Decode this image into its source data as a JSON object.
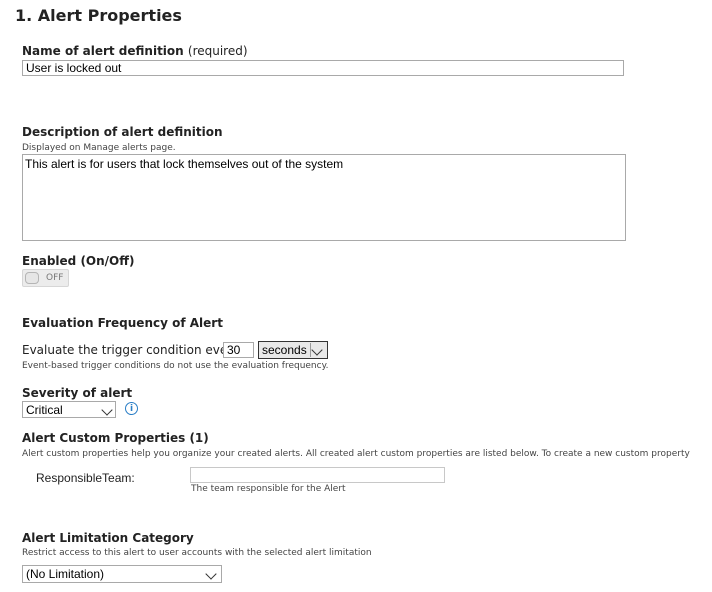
{
  "section_title": "1. Alert Properties",
  "name": {
    "label": "Name of alert definition",
    "required": "(required)",
    "value": "User is locked out"
  },
  "description": {
    "label": "Description of alert definition",
    "hint": "Displayed on Manage alerts page.",
    "value": "This alert is for users that lock themselves out of the system"
  },
  "enabled": {
    "label": "Enabled (On/Off)",
    "state_text": "OFF"
  },
  "evaluation": {
    "label": "Evaluation Frequency of Alert",
    "prefix": "Evaluate the trigger condition every",
    "interval_value": "30",
    "unit_selected": "seconds",
    "hint": "Event-based trigger conditions do not use the evaluation frequency."
  },
  "severity": {
    "label": "Severity of alert",
    "selected": "Critical",
    "info_icon": "info-icon"
  },
  "custom_properties": {
    "label": "Alert Custom Properties (1)",
    "hint": "Alert custom properties help you organize your created alerts. All created alert custom properties are listed below. To create a new custom property",
    "items": [
      {
        "name": "ResponsibleTeam:",
        "value": "",
        "hint": "The team responsible for the Alert"
      }
    ]
  },
  "limitation": {
    "label": "Alert Limitation Category",
    "hint": "Restrict access to this alert to user accounts with the selected alert limitation",
    "selected": "(No Limitation)"
  },
  "colors": {
    "info_blue": "#2a7ec6",
    "border_gray": "#a9a9a9"
  }
}
